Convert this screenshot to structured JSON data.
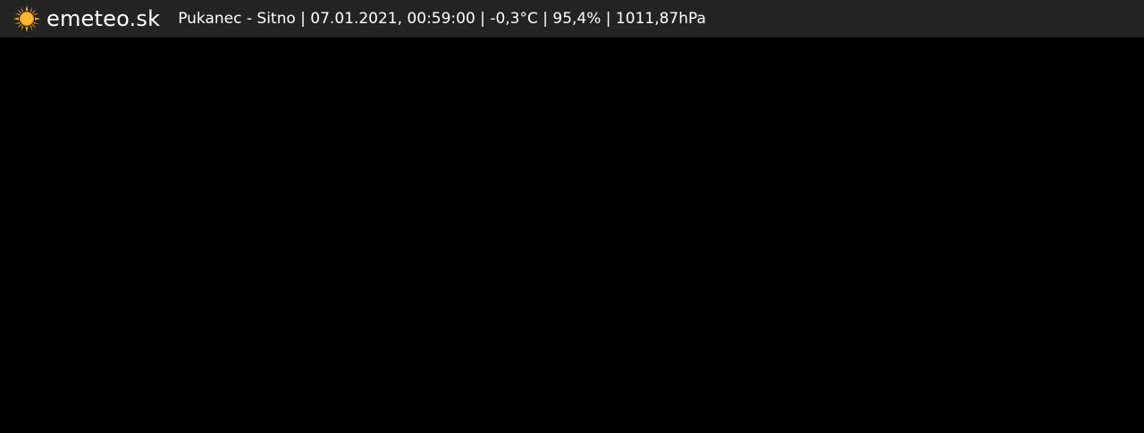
{
  "brand": {
    "logo_text": "emeteo.sk",
    "logo_icon": "sun-icon",
    "accent_color": "#f5a623"
  },
  "overlay": {
    "caption": "Pukanec - Sitno | 07.01.2021, 00:59:00 | -0,3°C | 95,4% | 1011,87hPa",
    "background_color": "#232323"
  },
  "feed": {
    "background_color": "#000000"
  }
}
